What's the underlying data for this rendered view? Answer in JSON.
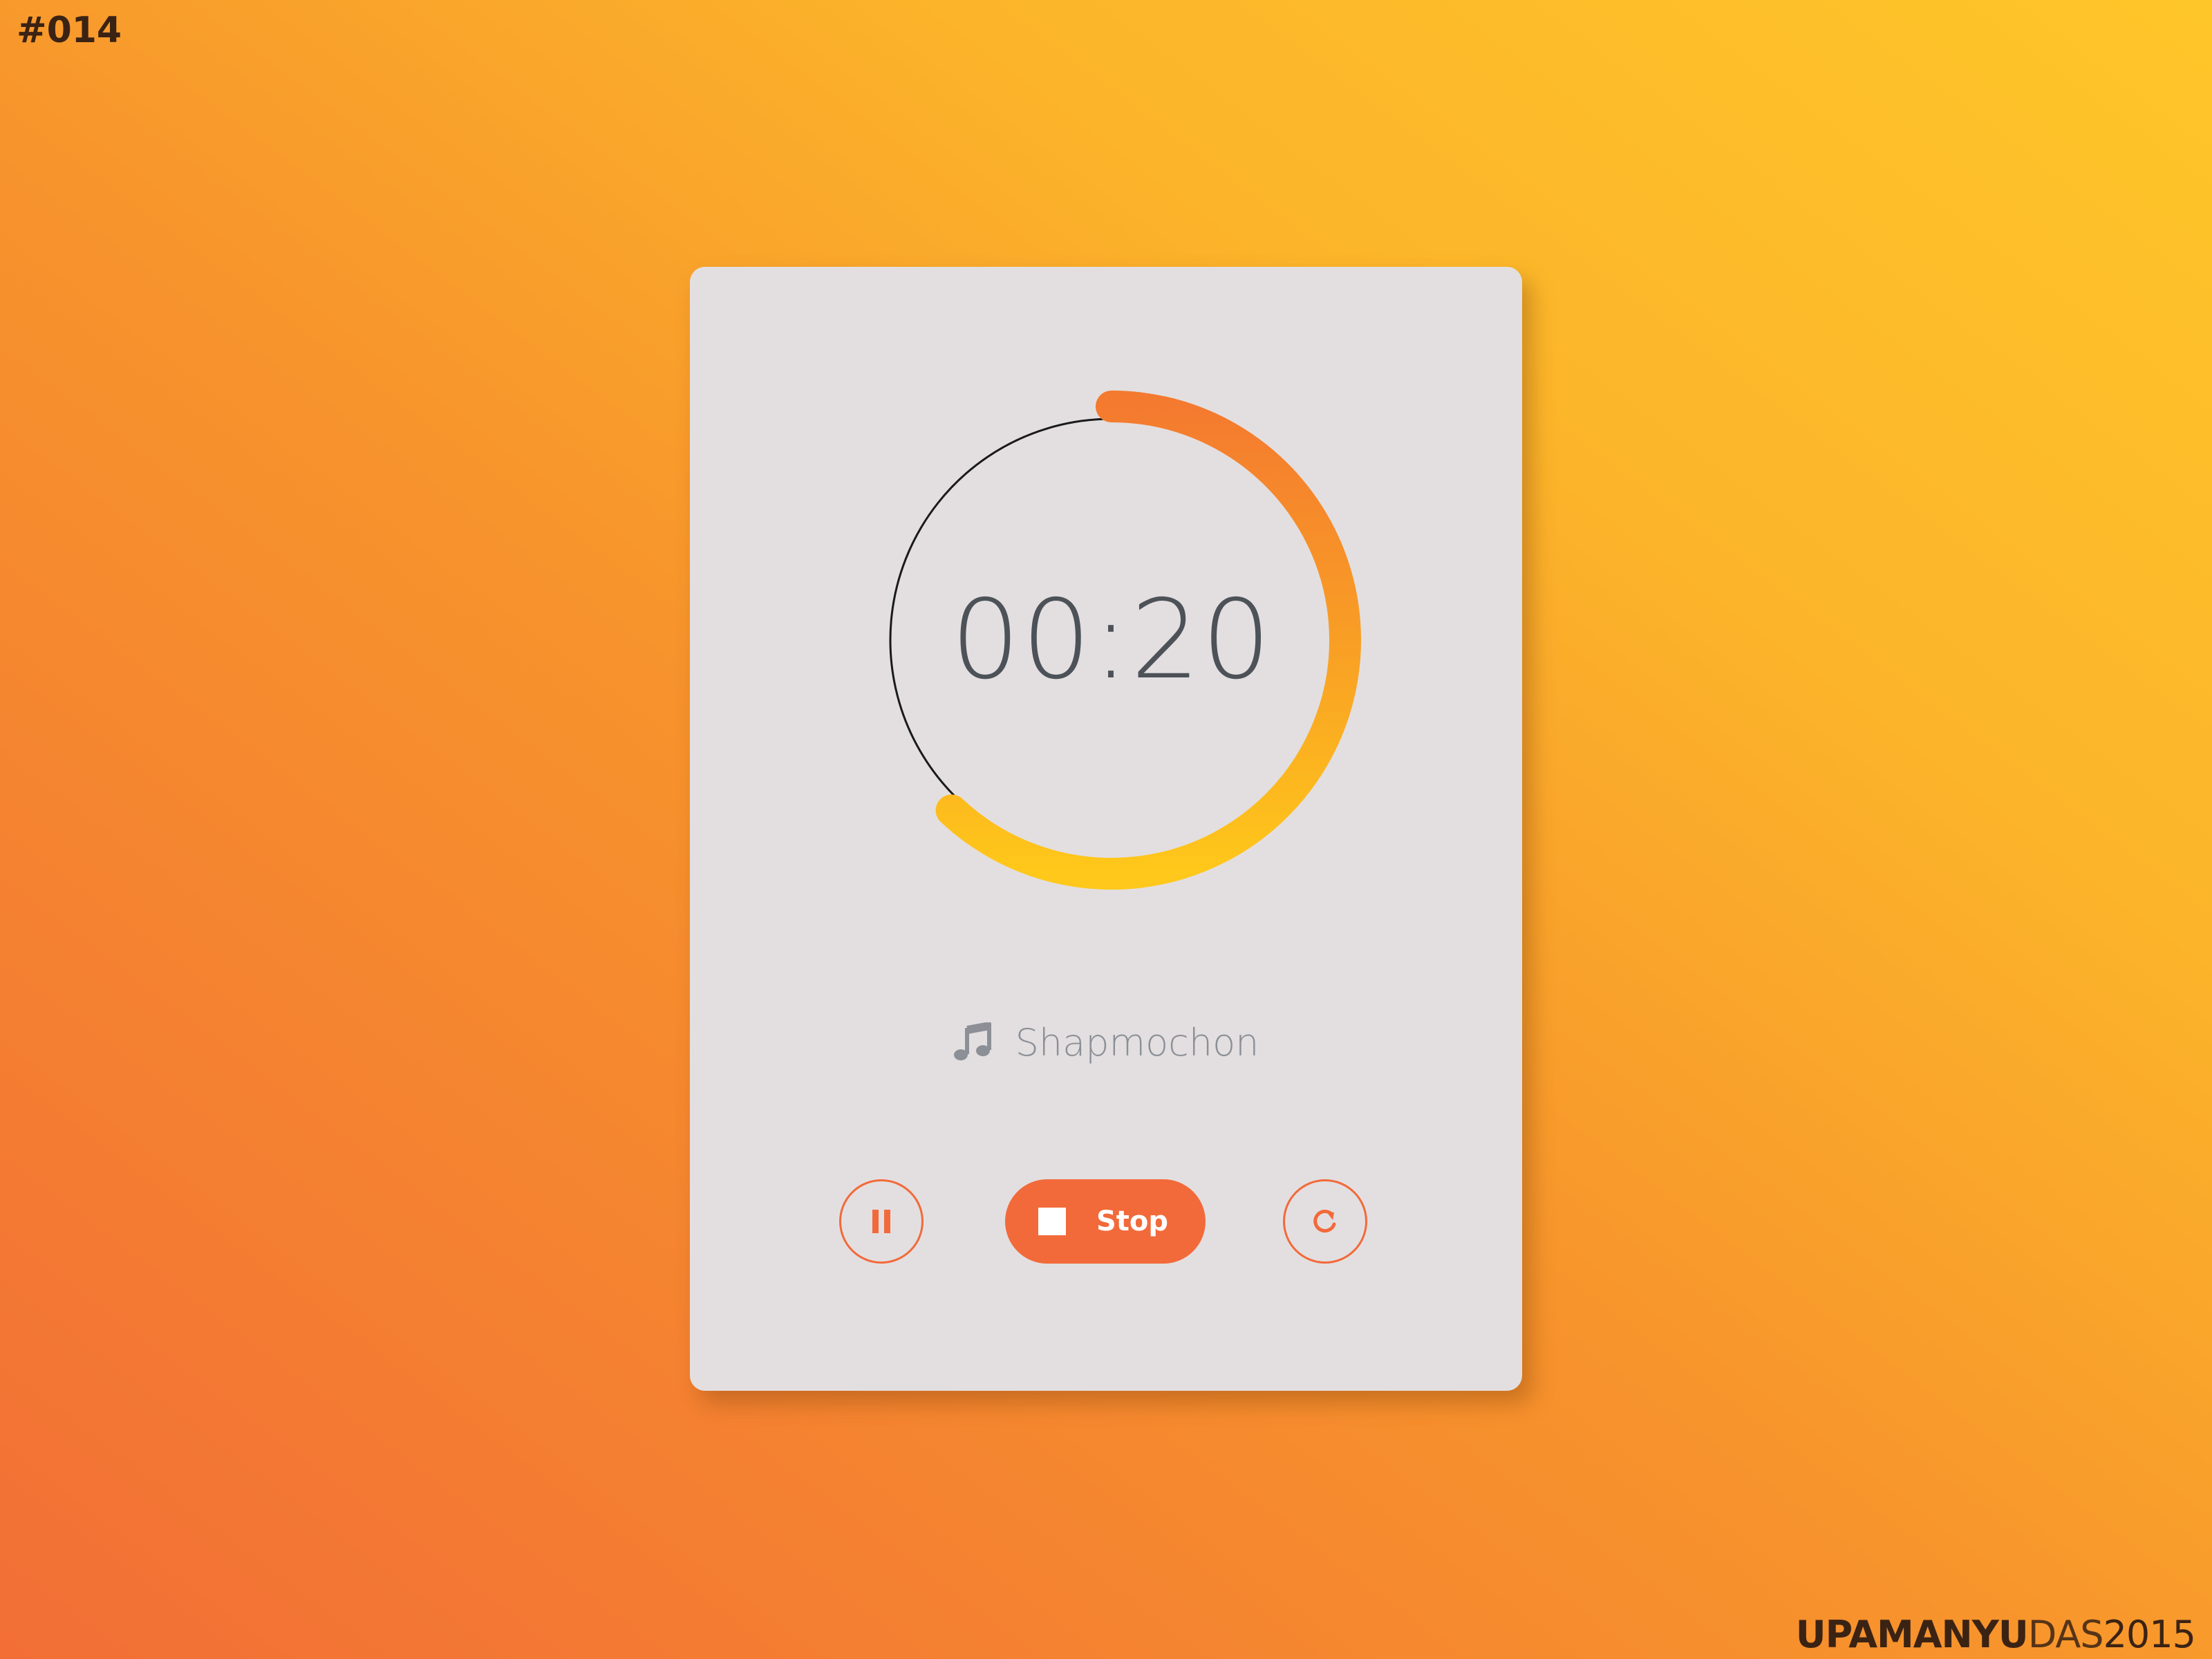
{
  "shot_label": "#014",
  "credit": {
    "strong": "UPAMANYU",
    "light": "DAS",
    "year": "2015"
  },
  "timer": {
    "time": "00:20",
    "progress_fraction": 0.62,
    "colors": {
      "arc_start": "#f47a2f",
      "arc_mid": "#f9a224",
      "arc_end": "#ffc81a",
      "track": "#1a1a1a"
    }
  },
  "song": {
    "icon": "music-note-icon",
    "title": "Shapmochon"
  },
  "controls": {
    "pause_icon": "pause-icon",
    "stop_label": "Stop",
    "stop_icon": "stop-icon",
    "reset_icon": "refresh-icon",
    "accent_color": "#f26a3a"
  },
  "card": {
    "background": "#e3dfe0"
  }
}
